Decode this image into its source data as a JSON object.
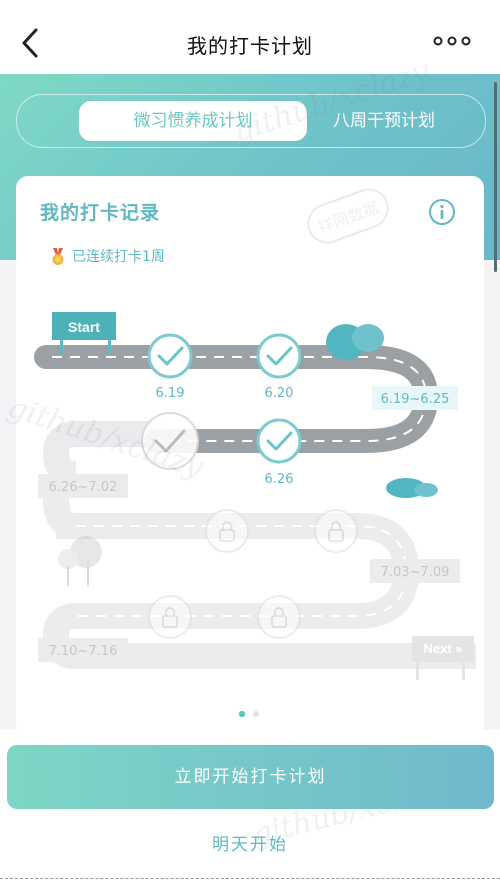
{
  "header": {
    "title": "我的打卡计划"
  },
  "tabs": [
    {
      "label": "微习惯养成计划",
      "active": true
    },
    {
      "label": "八周干预计划",
      "active": false
    }
  ],
  "card": {
    "title": "我的打卡记录",
    "streak": "已连续打卡1周"
  },
  "map": {
    "start_label": "Start",
    "next_label": "Next »",
    "nodes": [
      {
        "label": "6.19",
        "state": "done"
      },
      {
        "label": "6.20",
        "state": "done"
      },
      {
        "label": "6.26",
        "state": "done"
      },
      {
        "label": "",
        "state": "missed"
      },
      {
        "label": "",
        "state": "locked"
      },
      {
        "label": "",
        "state": "locked"
      },
      {
        "label": "",
        "state": "locked"
      },
      {
        "label": "",
        "state": "locked"
      }
    ],
    "week_labels": [
      "6.19~6.25",
      "6.26~7.02",
      "7.03~7.09",
      "7.10~7.16"
    ]
  },
  "pager": {
    "pages": 2,
    "current": 1
  },
  "actions": {
    "primary": "立即开始打卡计划",
    "secondary": "明天开始"
  },
  "watermarks": [
    "github/xclazy",
    "github/xclazy",
    "github/xclazy",
    "祥网数据"
  ],
  "colors": {
    "accent": "#5fb8c2",
    "road": "#9aa0a4",
    "check": "#6bc4c8",
    "locked": "#e8e8ea"
  }
}
